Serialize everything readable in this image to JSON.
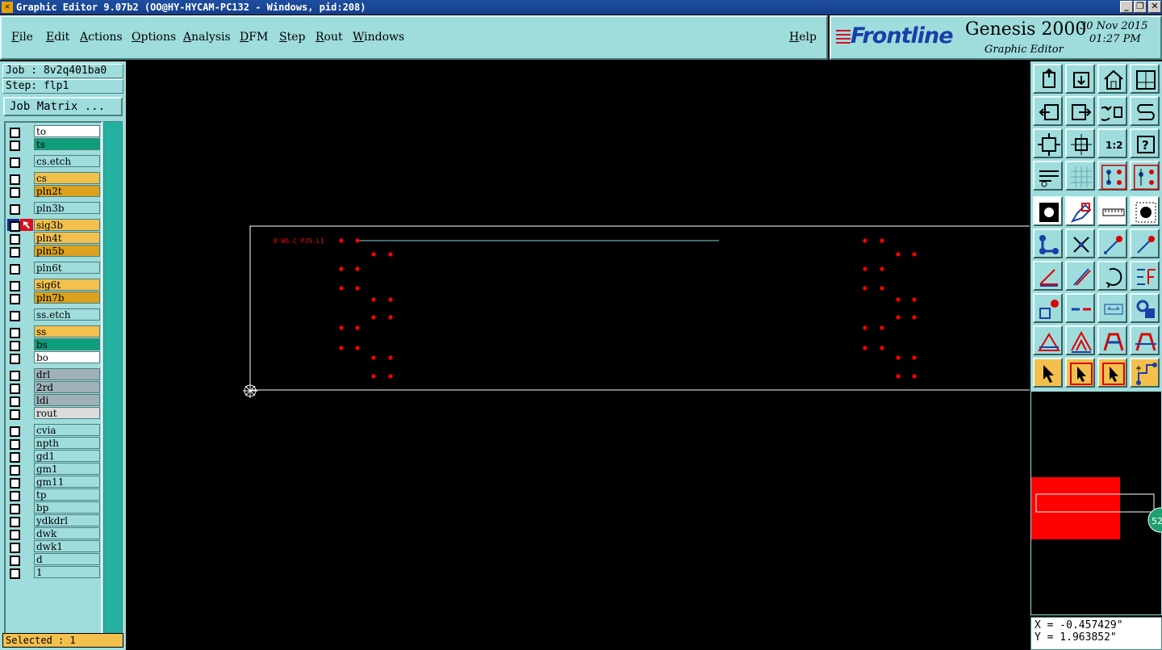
{
  "window": {
    "title": "Graphic Editor 9.07b2 (OO@HY-HYCAM-PC132 - Windows, pid:208)",
    "minimize": "_",
    "maximize": "❐",
    "close": "✕"
  },
  "menu": [
    "File",
    "Edit",
    "Actions",
    "Options",
    "Analysis",
    "DFM",
    "Step",
    "Rout",
    "Windows"
  ],
  "help": "Help",
  "brand": {
    "logo": "Frontline",
    "product": "Genesis 2000",
    "subproduct": "Graphic Editor",
    "date": "30 Nov 2015",
    "time": "01:27 PM"
  },
  "job": "Job : 8v2q401ba0",
  "step": "Step: flp1",
  "job_matrix": "Job Matrix ...",
  "layers": [
    {
      "name": "to",
      "color": "#ffffff"
    },
    {
      "name": "ts",
      "color": "#0f9e7c"
    },
    {
      "name": "cs.etch",
      "color": "#9fdcdc"
    },
    {
      "name": "cs",
      "color": "#f3c04e"
    },
    {
      "name": "pln2t",
      "color": "#dca11e"
    },
    {
      "name": "pln3b",
      "color": "#9fdcdc"
    },
    {
      "name": "sig3b",
      "color": "#f3c04e"
    },
    {
      "name": "pln4t",
      "color": "#f3c04e"
    },
    {
      "name": "pln5b",
      "color": "#dca11e"
    },
    {
      "name": "pln6t",
      "color": "#9fdcdc"
    },
    {
      "name": "sig6t",
      "color": "#f3c04e"
    },
    {
      "name": "pln7b",
      "color": "#dca11e"
    },
    {
      "name": "ss.etch",
      "color": "#9fdcdc"
    },
    {
      "name": "ss",
      "color": "#f3c04e"
    },
    {
      "name": "bs",
      "color": "#0f9e7c"
    },
    {
      "name": "bo",
      "color": "#ffffff"
    },
    {
      "name": "drl",
      "color": "#9fb0b8"
    },
    {
      "name": "2rd",
      "color": "#9fb0b8"
    },
    {
      "name": "ldi",
      "color": "#9fb0b8"
    },
    {
      "name": "rout",
      "color": "#dcdcdc"
    },
    {
      "name": "cvia",
      "color": "#9fdcdc"
    },
    {
      "name": "npth",
      "color": "#9fdcdc"
    },
    {
      "name": "gd1",
      "color": "#9fdcdc"
    },
    {
      "name": "gm1",
      "color": "#9fdcdc"
    },
    {
      "name": "gm11",
      "color": "#9fdcdc"
    },
    {
      "name": "tp",
      "color": "#9fdcdc"
    },
    {
      "name": "bp",
      "color": "#9fdcdc"
    },
    {
      "name": "ydkdrl",
      "color": "#9fdcdc"
    },
    {
      "name": "dwk",
      "color": "#9fdcdc"
    },
    {
      "name": "dwk1",
      "color": "#9fdcdc"
    },
    {
      "name": "d",
      "color": "#9fdcdc"
    },
    {
      "name": "1",
      "color": "#9fdcdc"
    }
  ],
  "active_layer": "sig3b",
  "selected": "Selected : 1",
  "canvas": {
    "board_label": "8 WS.C PJ5.L1",
    "pad_color": "#ff0000",
    "line_color": "#7fd6d6"
  },
  "overview": {
    "badge": "52"
  },
  "coords": {
    "x": "X = -0.457429\"",
    "y": "Y = 1.963852\""
  },
  "tools": [
    {
      "name": "open-icon"
    },
    {
      "name": "save-icon"
    },
    {
      "name": "home-icon"
    },
    {
      "name": "window-icon"
    },
    {
      "name": "exit-icon"
    },
    {
      "name": "enter-icon"
    },
    {
      "name": "undo-icon"
    },
    {
      "name": "snake-icon"
    },
    {
      "name": "zoom-fit-icon"
    },
    {
      "name": "zoom-center-icon"
    },
    {
      "name": "scale-icon"
    },
    {
      "name": "help-icon"
    },
    {
      "name": "settings-icon"
    },
    {
      "name": "grid-icon"
    },
    {
      "name": "layers-red-icon"
    },
    {
      "name": "layers-red2-icon"
    },
    {
      "name": "fill-icon"
    },
    {
      "name": "edit-shape-icon"
    },
    {
      "name": "ruler-icon"
    },
    {
      "name": "select-dot-icon"
    },
    {
      "name": "connect-icon"
    },
    {
      "name": "delete-icon"
    },
    {
      "name": "line-add-icon"
    },
    {
      "name": "line-move-icon"
    },
    {
      "name": "angle-icon"
    },
    {
      "name": "slash-icon"
    },
    {
      "name": "arc-icon"
    },
    {
      "name": "mirror-icon"
    },
    {
      "name": "pad-add-icon"
    },
    {
      "name": "line-break-icon"
    },
    {
      "name": "measure-icon"
    },
    {
      "name": "shape-icon"
    },
    {
      "name": "triangle-icon"
    },
    {
      "name": "peak-icon"
    },
    {
      "name": "arch-icon"
    },
    {
      "name": "arch-cut-icon"
    },
    {
      "name": "pointer-icon"
    },
    {
      "name": "pointer-box-icon"
    },
    {
      "name": "pointer-box2-icon"
    },
    {
      "name": "route-icon"
    }
  ]
}
